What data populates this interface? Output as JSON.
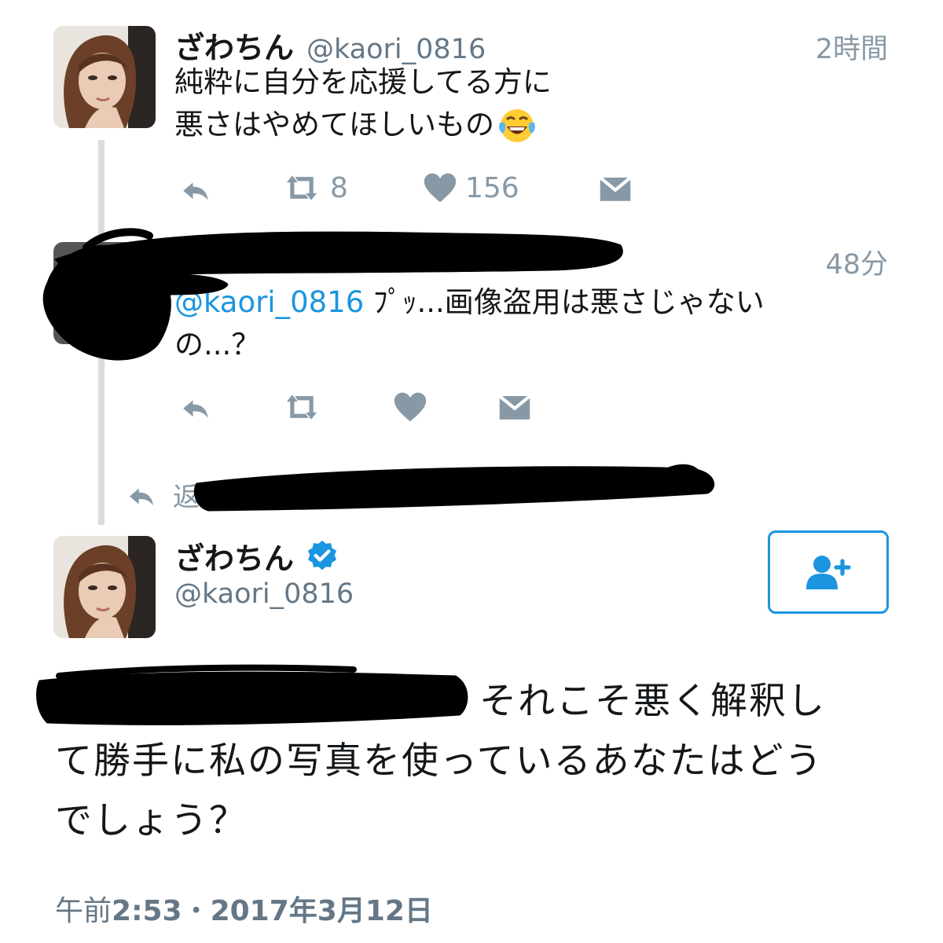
{
  "tweet1": {
    "name": "ざわちん",
    "handle": "@kaori_0816",
    "time": "2時間",
    "line1": "純粋に自分を応援してる方に",
    "line2": "悪さはやめてほしいもの",
    "emoji": "face-with-tears-of-joy",
    "retweet_count": "8",
    "like_count": "156"
  },
  "tweet2": {
    "time": "48分",
    "mention": "@kaori_0816",
    "text": "ﾌﾟｯ...画像盗用は悪さじゃない",
    "line2": "の...？"
  },
  "reply_prefix": "返",
  "main": {
    "name": "ざわちん",
    "handle": "@kaori_0816",
    "verified_badge": "verified-icon",
    "text_line1_tail": "それこそ悪く解釈し",
    "text_line2": "て勝手に私の写真を使っているあなたはどう",
    "text_line3": "でしょう？",
    "timestamp_prefix": "午前",
    "timestamp_time": "2:53",
    "timestamp_sep": "・",
    "timestamp_date": "2017年3月12日"
  },
  "colors": {
    "accent": "#1b95e0",
    "icon_gray": "#8899a6",
    "text": "#14171a",
    "muted": "#657786"
  }
}
